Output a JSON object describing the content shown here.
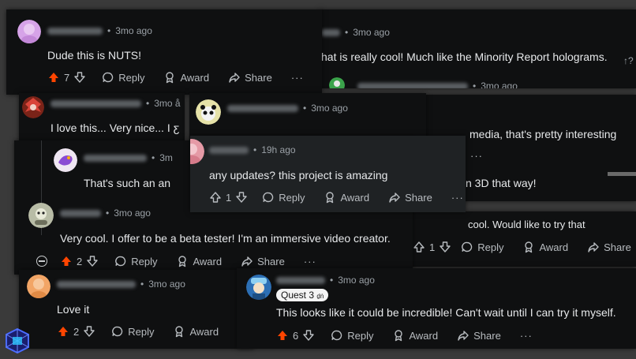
{
  "colors": {
    "upvote_active": "#ff4500",
    "panel_bg": "#0f1011",
    "hover_bg": "#1f2224",
    "text": "#e6e8ea"
  },
  "common": {
    "sep": "•",
    "reply": "Reply",
    "award": "Award",
    "share": "Share",
    "more": "···"
  },
  "c1": {
    "time": "3mo ago",
    "text": "Dude this is NUTS!",
    "votes": "7"
  },
  "c2": {
    "time": "3mo ago",
    "text": "hat is really cool! Much like the Minority Report holograms.",
    "extra": "↑?",
    "nexttime": "3mo ago"
  },
  "c3": {
    "time": "3mo å",
    "text": "I love this... Very nice... I ƹ"
  },
  "c4": {
    "time": "3mo ago"
  },
  "c5": {
    "time": "3m",
    "text": "That's such an an"
  },
  "c6": {
    "text_fragment": "media, that's pretty interesting",
    "frag2": "n 3D that way!"
  },
  "c7": {
    "time": "19h ago",
    "text": "any updates? this project is amazing",
    "votes": "1"
  },
  "c8": {
    "time": "3mo ago",
    "text": "Very cool. I offer to be a beta tester! I'm an immersive video creator.",
    "votes": "2"
  },
  "c9": {
    "text": "cool. Would like to try that",
    "votes": "1"
  },
  "c10": {
    "time": "3mo ago",
    "text": "Love it",
    "votes": "2"
  },
  "c11": {
    "time": "3mo ago",
    "badge": "Quest 3",
    "badge_extra": "ḏṅ",
    "text": "This looks like it could be incredible! Can't wait until I can try it myself.",
    "votes": "6"
  }
}
